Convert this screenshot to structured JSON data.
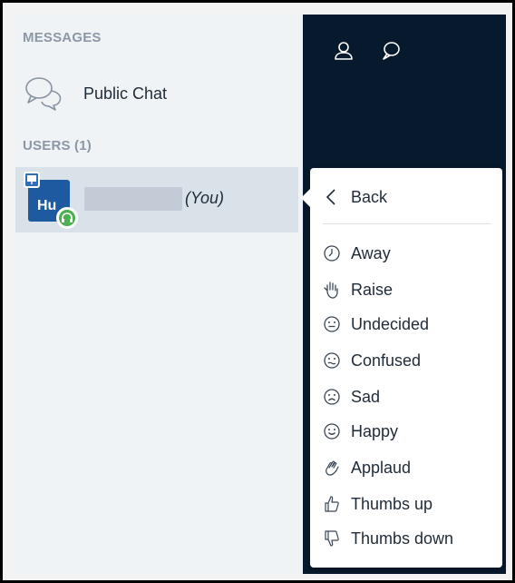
{
  "messages": {
    "section_title": "MESSAGES",
    "public_chat_label": "Public Chat"
  },
  "users": {
    "section_title": "USERS (1)",
    "current_user": {
      "initials": "Hu",
      "you_label": "(You)"
    }
  },
  "status_menu": {
    "back_label": "Back",
    "items": [
      {
        "label": "Away",
        "icon": "clock-icon"
      },
      {
        "label": "Raise",
        "icon": "raise-hand-icon"
      },
      {
        "label": "Undecided",
        "icon": "neutral-face-icon"
      },
      {
        "label": "Confused",
        "icon": "confused-face-icon"
      },
      {
        "label": "Sad",
        "icon": "sad-face-icon"
      },
      {
        "label": "Happy",
        "icon": "happy-face-icon"
      },
      {
        "label": "Applaud",
        "icon": "applaud-icon"
      },
      {
        "label": "Thumbs up",
        "icon": "thumbs-up-icon"
      },
      {
        "label": "Thumbs down",
        "icon": "thumbs-down-icon"
      }
    ]
  },
  "colors": {
    "sidebar_bg": "#f0f3f6",
    "selected_row_bg": "#d9e1e9",
    "dark_panel_bg": "#07192c",
    "avatar_bg": "#1e5aa0",
    "headset_badge": "#4caf50",
    "section_title": "#8b97a6"
  }
}
